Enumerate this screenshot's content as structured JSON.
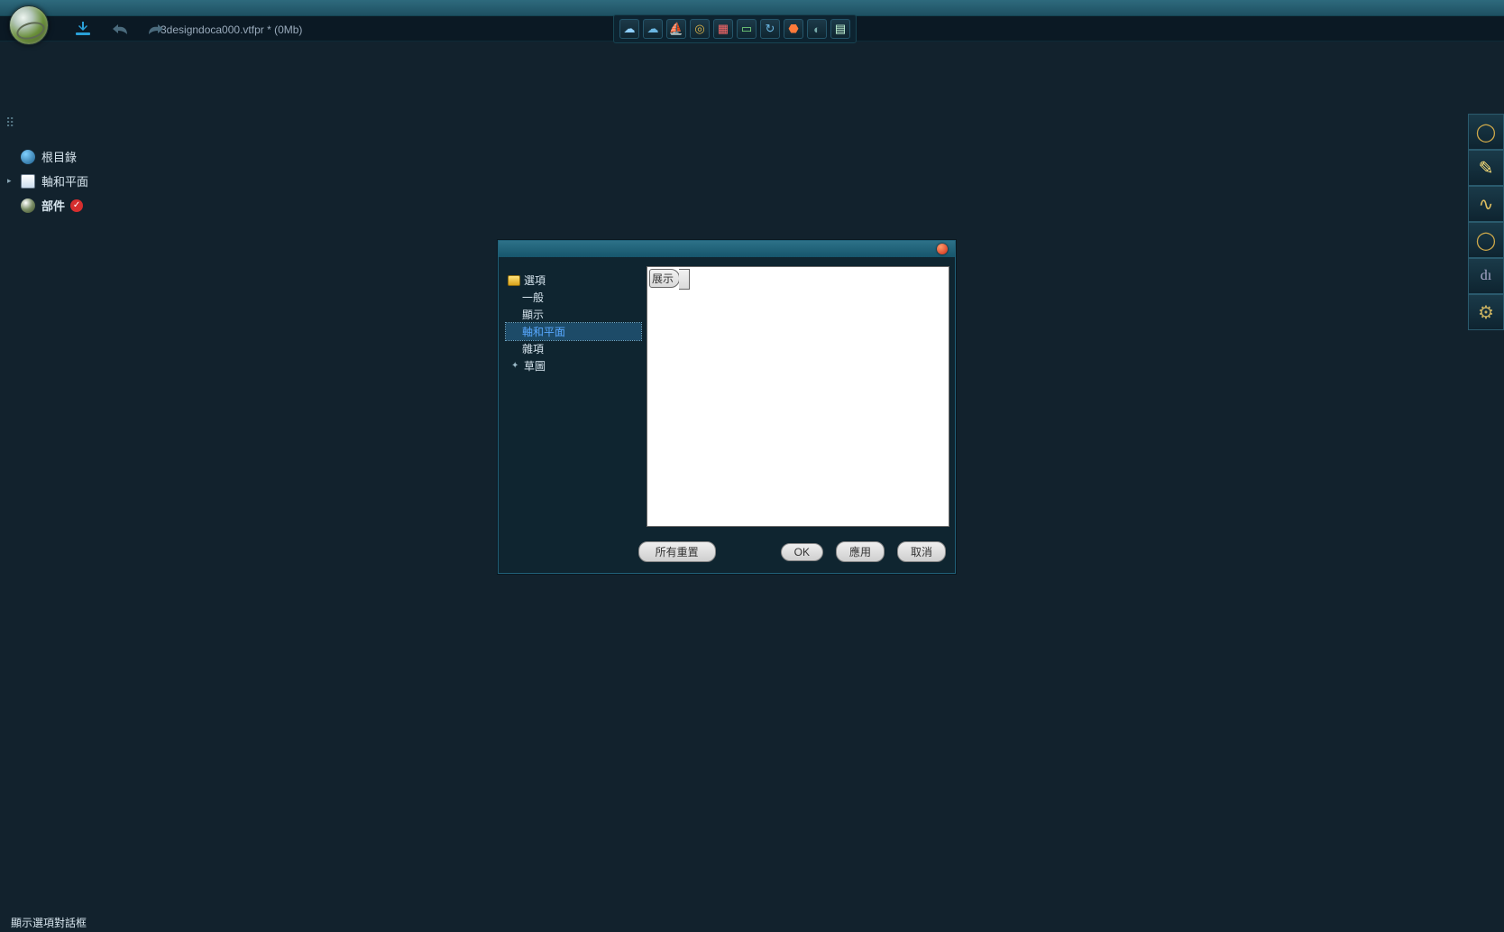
{
  "app": {
    "document_title": "3designdoca000.vtfpr * (0Mb)"
  },
  "topbar_icons": [
    "download-icon",
    "undo-icon",
    "redo-icon"
  ],
  "center_tools": [
    "cloud-a",
    "cloud-b",
    "boat",
    "target",
    "qr",
    "doc",
    "sync",
    "drop",
    "moon",
    "grid"
  ],
  "right_rail": [
    "ring-1",
    "curve",
    "snake",
    "ring-2",
    "di",
    "gear"
  ],
  "scene_tree": {
    "root_label": "根目錄",
    "axis_label": "軸和平面",
    "parts_label": "部件"
  },
  "dialog": {
    "nav": {
      "options": "選項",
      "general": "一般",
      "display": "顯示",
      "axis": "軸和平面",
      "misc": "雜項",
      "sketch": "草圖"
    },
    "canvas_tab": "展示",
    "buttons": {
      "reset_all": "所有重置",
      "ok": "OK",
      "apply": "應用",
      "cancel": "取消"
    }
  },
  "statusbar": {
    "text": "顯示選項對話框"
  }
}
